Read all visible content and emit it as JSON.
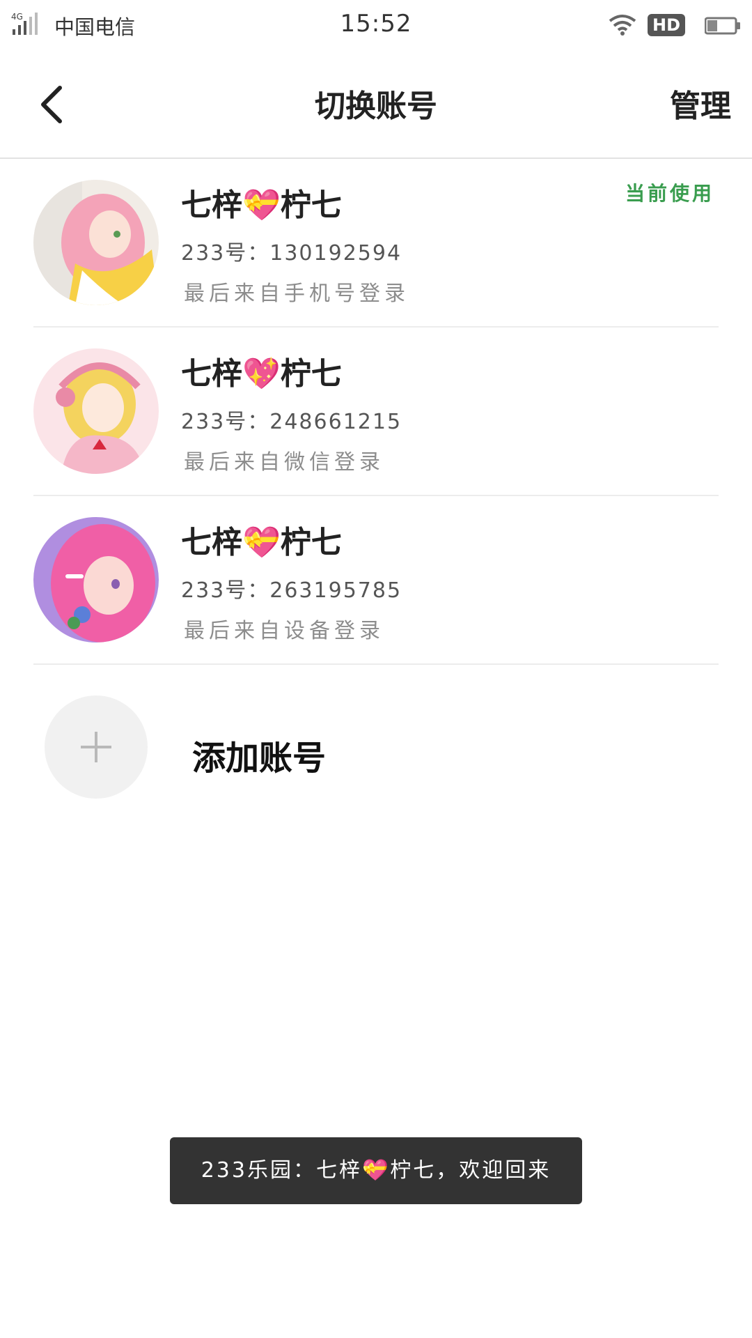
{
  "status_bar": {
    "network": "4G",
    "carrier": "中国电信",
    "time": "15:52",
    "hd_badge": "HD"
  },
  "header": {
    "title": "切换账号",
    "manage_label": "管理",
    "back_icon": "chevron-left-icon"
  },
  "accounts": [
    {
      "name": "七梓💝柠七",
      "uid": "233号：130192594",
      "login_source": "最后来自手机号登录",
      "current_label": "当前使用"
    },
    {
      "name": "七梓💖柠七",
      "uid": "233号：248661215",
      "login_source": "最后来自微信登录"
    },
    {
      "name": "七梓💝柠七",
      "uid": "233号：263195785",
      "login_source": "最后来自设备登录"
    }
  ],
  "add_account": {
    "label": "添加账号",
    "icon": "plus-icon"
  },
  "toast": {
    "text": "233乐园：七梓💝柠七，欢迎回来"
  }
}
